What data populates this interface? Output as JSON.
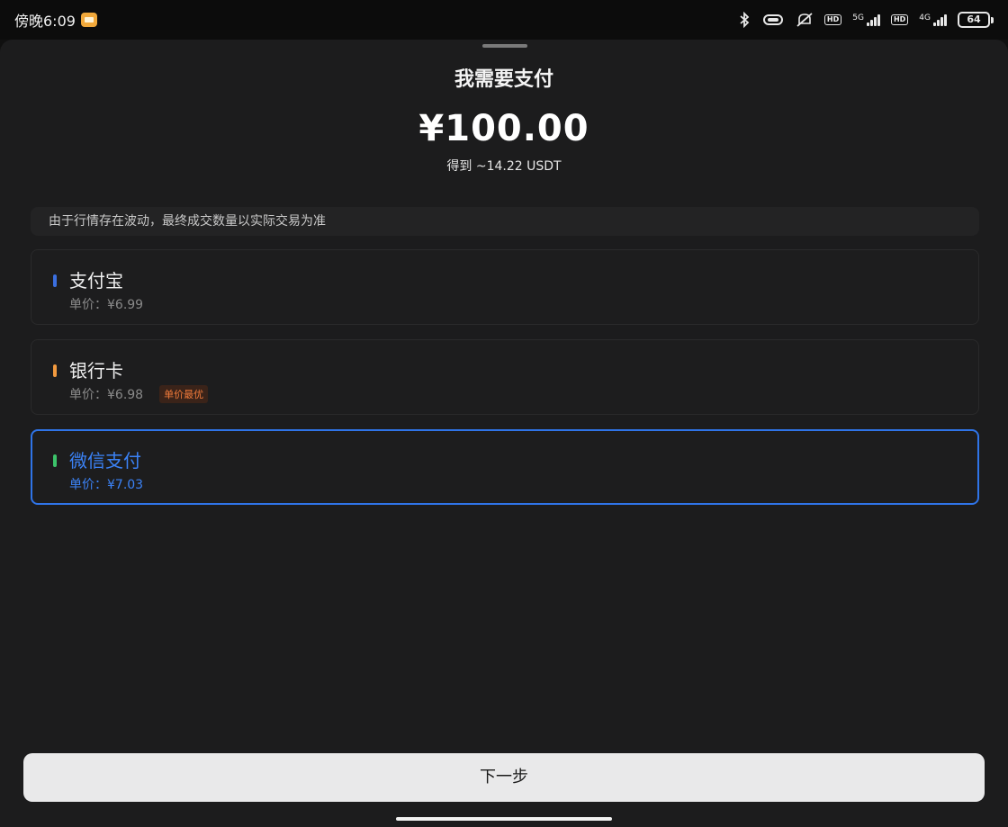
{
  "status_bar": {
    "time": "傍晚6:09",
    "net1_label": "5G",
    "net2_label": "4G",
    "hd": "HD",
    "battery": "64"
  },
  "sheet": {
    "title": "我需要支付",
    "amount": "¥100.00",
    "receive": "得到 ~14.22 USDT",
    "notice": "由于行情存在波动，最终成交数量以实际交易为准",
    "options": [
      {
        "name": "支付宝",
        "price": "单价：¥6.99",
        "bar_color": "#3b6fe0",
        "tag": "",
        "selected": false
      },
      {
        "name": "银行卡",
        "price": "单价：¥6.98",
        "bar_color": "#f29a3f",
        "tag": "单价最优",
        "selected": false
      },
      {
        "name": "微信支付",
        "price": "单价：¥7.03",
        "bar_color": "#3cc36a",
        "tag": "",
        "selected": true
      }
    ],
    "next_label": "下一步"
  }
}
